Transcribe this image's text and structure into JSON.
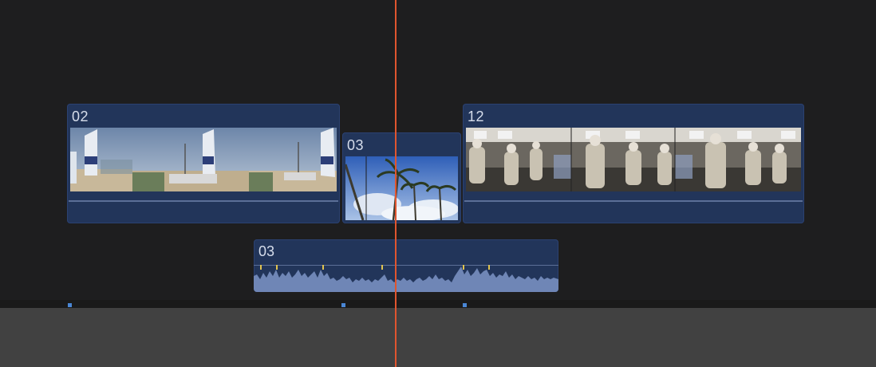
{
  "timeline": {
    "clips": [
      {
        "id": "clip-02",
        "label": "02",
        "scene": "beach-sailboats"
      },
      {
        "id": "clip-03-video",
        "label": "03",
        "scene": "palm-trees-sky"
      },
      {
        "id": "clip-12",
        "label": "12",
        "scene": "crowd-restaurant"
      }
    ],
    "audio_clip": {
      "label": "03"
    },
    "colors": {
      "clip_fill": "#22355a",
      "playhead": "#e0552f",
      "marker": "#4a87d6",
      "waveform": "#6f86b6",
      "background": "#1e1e1f",
      "panel": "#414141"
    }
  }
}
